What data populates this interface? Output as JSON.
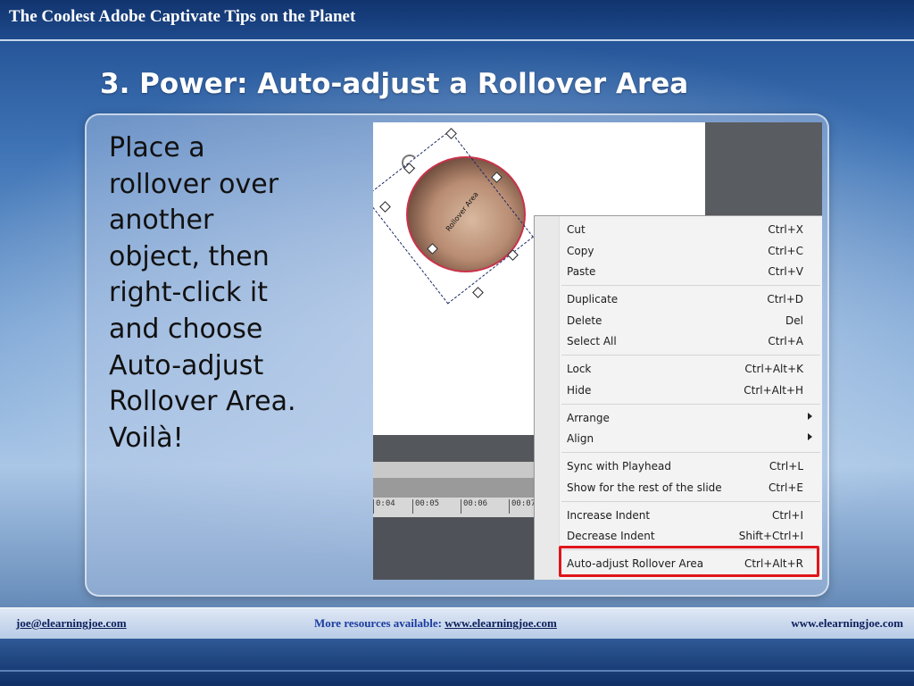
{
  "header": {
    "title": "The Coolest Adobe Captivate Tips on the Planet"
  },
  "slide": {
    "title": "3. Power: Auto-adjust a Rollover Area",
    "body": "Place a\nrollover over\nanother\nobject, then\nright-click it\nand choose\nAuto-adjust\nRollover Area.\nVoilà!"
  },
  "screenshot": {
    "rollover_label": "Rollover Area",
    "timeline_ticks": [
      "0:04",
      "00:05",
      "00:06",
      "00:07"
    ],
    "context_menu": {
      "items": [
        {
          "label": "Cut",
          "shortcut": "Ctrl+X"
        },
        {
          "label": "Copy",
          "shortcut": "Ctrl+C"
        },
        {
          "label": "Paste",
          "shortcut": "Ctrl+V"
        },
        {
          "label": "Duplicate",
          "shortcut": "Ctrl+D"
        },
        {
          "label": "Delete",
          "shortcut": "Del"
        },
        {
          "label": "Select All",
          "shortcut": "Ctrl+A"
        },
        {
          "label": "Lock",
          "shortcut": "Ctrl+Alt+K"
        },
        {
          "label": "Hide",
          "shortcut": "Ctrl+Alt+H"
        },
        {
          "label": "Arrange",
          "shortcut": ""
        },
        {
          "label": "Align",
          "shortcut": ""
        },
        {
          "label": "Sync with Playhead",
          "shortcut": "Ctrl+L"
        },
        {
          "label": "Show for the rest of the slide",
          "shortcut": "Ctrl+E"
        },
        {
          "label": "Increase Indent",
          "shortcut": "Ctrl+I"
        },
        {
          "label": "Decrease Indent",
          "shortcut": "Shift+Ctrl+I"
        },
        {
          "label": "Auto-adjust Rollover Area",
          "shortcut": "Ctrl+Alt+R"
        }
      ],
      "highlight_color": "#e0161c"
    }
  },
  "footer": {
    "email": "joe@elearningjoe.com",
    "resources_label": "More resources available:",
    "resources_link": "www.elearningjoe.com",
    "site": "www.elearningjoe.com"
  },
  "colors": {
    "header_bg": "#11346e",
    "title_text": "#ffffff",
    "footer_text": "#0d1f5c"
  }
}
